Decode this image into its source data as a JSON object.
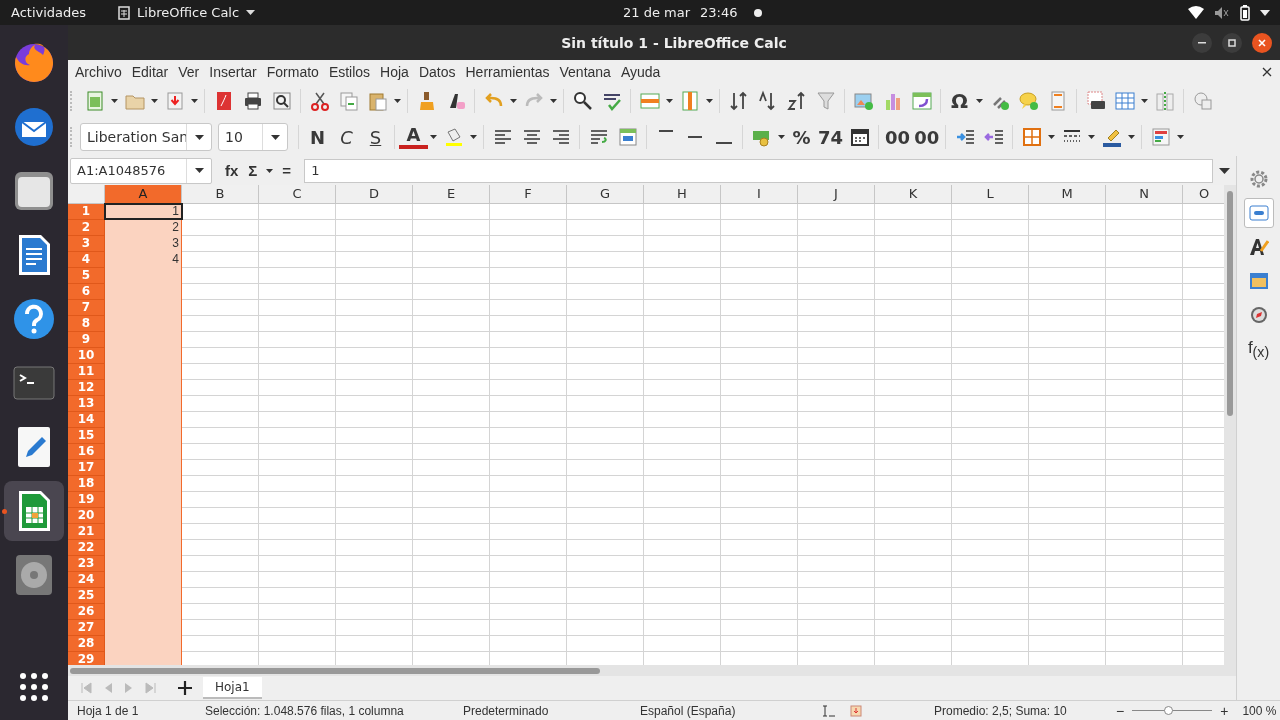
{
  "top_bar": {
    "activities": "Actividades",
    "app_menu": "LibreOffice Calc",
    "date": "21 de mar",
    "time": "23:46"
  },
  "dock": [
    {
      "kind": "browser",
      "selected": false,
      "running": false
    },
    {
      "kind": "mail",
      "selected": false,
      "running": false
    },
    {
      "kind": "files",
      "selected": false,
      "running": false
    },
    {
      "kind": "writer",
      "selected": false,
      "running": false
    },
    {
      "kind": "help",
      "selected": false,
      "running": false
    },
    {
      "kind": "terminal",
      "selected": false,
      "running": false
    },
    {
      "kind": "editor",
      "selected": false,
      "running": false
    },
    {
      "kind": "calc",
      "selected": true,
      "running": true
    },
    {
      "kind": "disc",
      "selected": false,
      "running": false
    }
  ],
  "window": {
    "title": "Sin título 1 - LibreOffice Calc"
  },
  "menu": [
    "Archivo",
    "Editar",
    "Ver",
    "Insertar",
    "Formato",
    "Estilos",
    "Hoja",
    "Datos",
    "Herramientas",
    "Ventana",
    "Ayuda"
  ],
  "toolbar_1": {
    "glyphs": [
      "Ω"
    ]
  },
  "toolbar_2": {
    "font_name": "Liberation San",
    "font_size": "10",
    "glyphs": [
      "N",
      "C",
      "S",
      "A",
      "%",
      "74",
      "00",
      "00"
    ]
  },
  "formula_bar": {
    "name_box": "A1:A1048576",
    "glyphs": [
      "fx",
      "Σ",
      "="
    ],
    "formula": "1"
  },
  "grid": {
    "columns": [
      {
        "label": "A",
        "selected": true
      },
      {
        "label": "B",
        "selected": false
      },
      {
        "label": "C",
        "selected": false
      },
      {
        "label": "D",
        "selected": false
      },
      {
        "label": "E",
        "selected": false
      },
      {
        "label": "F",
        "selected": false
      },
      {
        "label": "G",
        "selected": false
      },
      {
        "label": "H",
        "selected": false
      },
      {
        "label": "I",
        "selected": false
      },
      {
        "label": "J",
        "selected": false
      },
      {
        "label": "K",
        "selected": false
      },
      {
        "label": "L",
        "selected": false
      },
      {
        "label": "M",
        "selected": false
      },
      {
        "label": "N",
        "selected": false
      },
      {
        "label": "O",
        "selected": false
      }
    ],
    "rows": [
      {
        "label": "1",
        "selected": true,
        "cells": [
          {
            "text": "1",
            "active": true
          }
        ]
      },
      {
        "label": "2",
        "selected": true,
        "cells": [
          {
            "text": "2",
            "active": false
          }
        ]
      },
      {
        "label": "3",
        "selected": true,
        "cells": [
          {
            "text": "3",
            "active": false
          }
        ]
      },
      {
        "label": "4",
        "selected": true,
        "cells": [
          {
            "text": "4",
            "active": false
          }
        ]
      },
      {
        "label": "5",
        "selected": true
      },
      {
        "label": "6",
        "selected": true
      },
      {
        "label": "7",
        "selected": true
      },
      {
        "label": "8",
        "selected": true
      },
      {
        "label": "9",
        "selected": true
      },
      {
        "label": "10",
        "selected": true
      },
      {
        "label": "11",
        "selected": true
      },
      {
        "label": "12",
        "selected": true
      },
      {
        "label": "13",
        "selected": true
      },
      {
        "label": "14",
        "selected": true
      },
      {
        "label": "15",
        "selected": true
      },
      {
        "label": "16",
        "selected": true
      },
      {
        "label": "17",
        "selected": true
      },
      {
        "label": "18",
        "selected": true
      },
      {
        "label": "19",
        "selected": true
      },
      {
        "label": "20",
        "selected": true
      },
      {
        "label": "21",
        "selected": true
      },
      {
        "label": "22",
        "selected": true
      },
      {
        "label": "23",
        "selected": true
      },
      {
        "label": "24",
        "selected": true
      },
      {
        "label": "25",
        "selected": true
      },
      {
        "label": "26",
        "selected": true
      },
      {
        "label": "27",
        "selected": true
      },
      {
        "label": "28",
        "selected": true
      },
      {
        "label": "29",
        "selected": true
      }
    ]
  },
  "sidebar": [
    {
      "kind": "settings",
      "selected": false
    },
    {
      "kind": "properties",
      "selected": true
    },
    {
      "kind": "styles",
      "selected": false
    },
    {
      "kind": "gallery",
      "selected": false
    },
    {
      "kind": "navigator",
      "selected": false
    },
    {
      "kind": "functions",
      "selected": false,
      "label": "f$_{(x)}$"
    }
  ],
  "sheet_tabs": [
    {
      "label": "Hoja1",
      "selected": true
    }
  ],
  "status_bar": {
    "sheet": "Hoja 1 de 1",
    "selection": "Selección: 1.048.576 filas, 1 columna",
    "style": "Predeterminado",
    "language": "Español (España)",
    "stats": "Promedio: 2,5; Suma: 10",
    "zoom_minus": "−",
    "zoom": {
      "level": 0.45
    },
    "zoom_plus": "+",
    "zoom_percent": "100 %"
  }
}
